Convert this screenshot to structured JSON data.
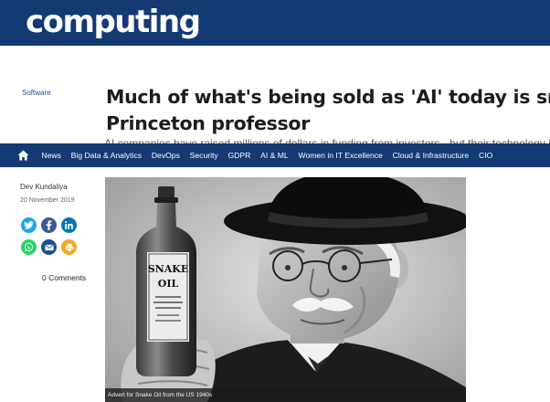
{
  "site": {
    "logo_text": "computing"
  },
  "article": {
    "category": "Software",
    "headline_line1": "Much of what's being sold as 'AI' today is snake oil, says",
    "headline_line2": "Princeton professor",
    "subhead": "AI companies have raised millions of dollars in funding from investors - but their technology isn't",
    "author": "Dev Kundaliya",
    "date": "20 November 2019",
    "comments": "0 Comments"
  },
  "nav": {
    "items": [
      "News",
      "Big Data & Analytics",
      "DevOps",
      "Security",
      "GDPR",
      "AI & ML",
      "Women in IT Excellence",
      "Cloud & Infrastructure",
      "CIO"
    ]
  },
  "image": {
    "caption": "Advert for Snake Oil from the US 1940s",
    "bottle_label_line1": "SNAKE",
    "bottle_label_line2": "OIL"
  },
  "share_icons": [
    "twitter-icon",
    "facebook-icon",
    "linkedin-icon",
    "whatsapp-icon",
    "email-icon",
    "print-icon"
  ],
  "colors": {
    "brand_navy": "#133a72",
    "twitter": "#1da1f2",
    "facebook": "#3b5998",
    "linkedin": "#0077b5",
    "whatsapp": "#25d366",
    "print": "#f4a81d"
  }
}
